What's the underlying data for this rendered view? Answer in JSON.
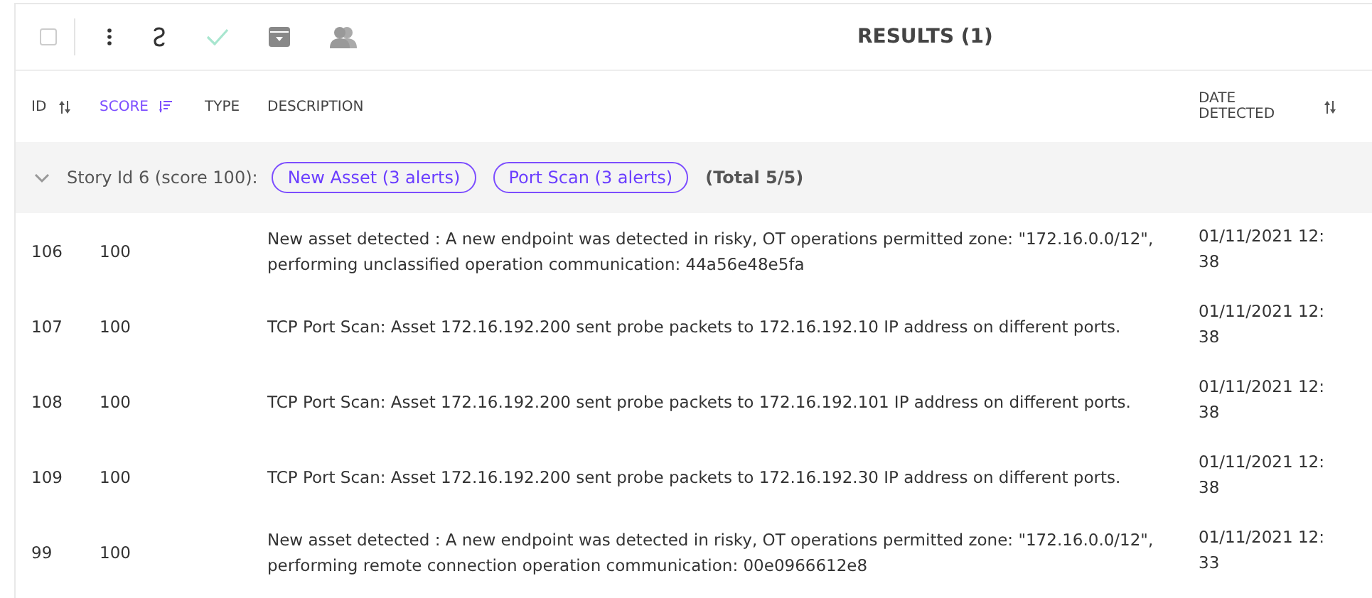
{
  "toolbar": {
    "select_all": {
      "checked": false
    },
    "title": "RESULTS (1)"
  },
  "table": {
    "columns": [
      {
        "label": "ID",
        "sorted": false
      },
      {
        "label": "SCORE",
        "sorted": true
      },
      {
        "label": "TYPE"
      },
      {
        "label": "DESCRIPTION"
      },
      {
        "label": "DATE DETECTED",
        "sorted": false
      }
    ],
    "group": {
      "expanded": true,
      "label": "Story Id 6 (score 100):",
      "tags": [
        "New Asset (3 alerts)",
        "Port Scan (3 alerts)"
      ],
      "total": "(Total 5/5)"
    },
    "rows": [
      {
        "id": "106",
        "score": "100",
        "description": "New asset detected : A new endpoint was detected in risky, OT operations permitted zone: \"172.16.0.0/12\", performing unclassified operation communication: 44a56e48e5fa",
        "date": "01/11/2021 12:38"
      },
      {
        "id": "107",
        "score": "100",
        "description": "TCP Port Scan: Asset 172.16.192.200 sent probe packets to 172.16.192.10 IP address on different ports.",
        "date": "01/11/2021 12:38"
      },
      {
        "id": "108",
        "score": "100",
        "description": "TCP Port Scan: Asset 172.16.192.200 sent probe packets to 172.16.192.101 IP address on different ports.",
        "date": "01/11/2021 12:38"
      },
      {
        "id": "109",
        "score": "100",
        "description": "TCP Port Scan: Asset 172.16.192.200 sent probe packets to 172.16.192.30 IP address on different ports.",
        "date": "01/11/2021 12:38"
      },
      {
        "id": "99",
        "score": "100",
        "description": "New asset detected : A new endpoint was detected in risky, OT operations permitted zone: \"172.16.0.0/12\", performing remote connection operation communication: 00e0966612e8",
        "date": "01/11/2021 12:33"
      }
    ]
  }
}
